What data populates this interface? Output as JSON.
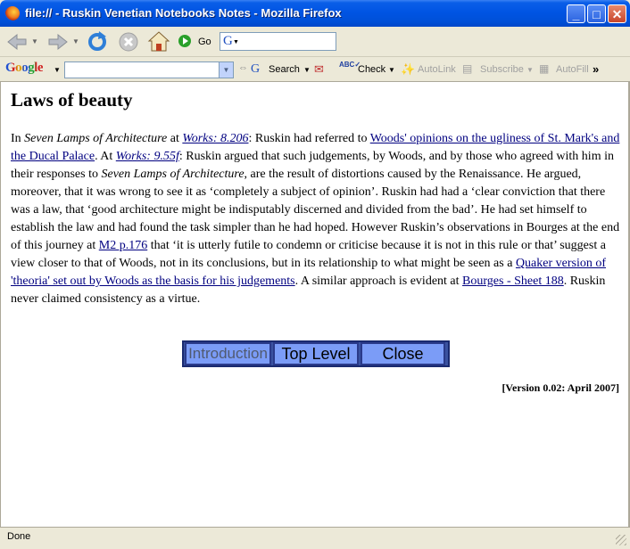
{
  "window": {
    "title": "file:// - Ruskin Venetian Notebooks Notes - Mozilla Firefox",
    "controls": {
      "minimize": "_",
      "maximize": "□",
      "close": "✕"
    }
  },
  "nav": {
    "go_label": "Go",
    "icons": [
      "back-icon",
      "forward-icon",
      "reload-icon",
      "stop-icon",
      "home-icon",
      "go-icon"
    ]
  },
  "google_toolbar": {
    "logo": "Google",
    "search_label": "Search",
    "check_label": "Check",
    "autolink_label": "AutoLink",
    "subscribe_label": "Subscribe",
    "autofill_label": "AutoFill",
    "more_label": "»"
  },
  "page": {
    "title": "Laws of beauty",
    "p": {
      "t1": "In ",
      "i1": "Seven Lamps of Architecture",
      "t2": " at ",
      "l1": "Works: 8.206",
      "t3": ": Ruskin had referred to ",
      "l2": "Woods' opinions on the ugliness of St. Mark's and the Ducal Palace",
      "t4": ". At ",
      "l3": "Works: 9.55f",
      "t5": ": Ruskin argued that such judgements, by Woods, and by those who agreed with him in their responses to ",
      "i2": "Seven Lamps of Architecture",
      "t6": ", are the result of distortions caused by the Renaissance. He argued, moreover, that it was wrong to see it as ‘completely a subject of opinion’. Ruskin had had a ‘clear conviction that there was a law, that ‘good architecture might be indisputably discerned and divided from the bad’. He had set himself to establish the law and had found the task simpler than he had hoped. However Ruskin’s observations in Bourges at the end of this journey at ",
      "l4": "M2 p.176",
      "t7": " that ‘it is utterly futile to condemn or criticise because it is not in this rule or that’ suggest a view closer to that of Woods, not in its conclusions, but in its relationship to what might be seen as a ",
      "l5": "Quaker version of 'theoria' set out by Woods as the basis for his judgements",
      "t8": ". A similar approach is evident at ",
      "l6": "Bourges - Sheet 188",
      "t9": ". Ruskin never claimed consistency as a virtue."
    },
    "buttons": {
      "intro": "Introduction",
      "top": "Top Level",
      "close": "Close"
    },
    "version": "[Version 0.02: April 2007]"
  },
  "status": {
    "text": "Done"
  }
}
